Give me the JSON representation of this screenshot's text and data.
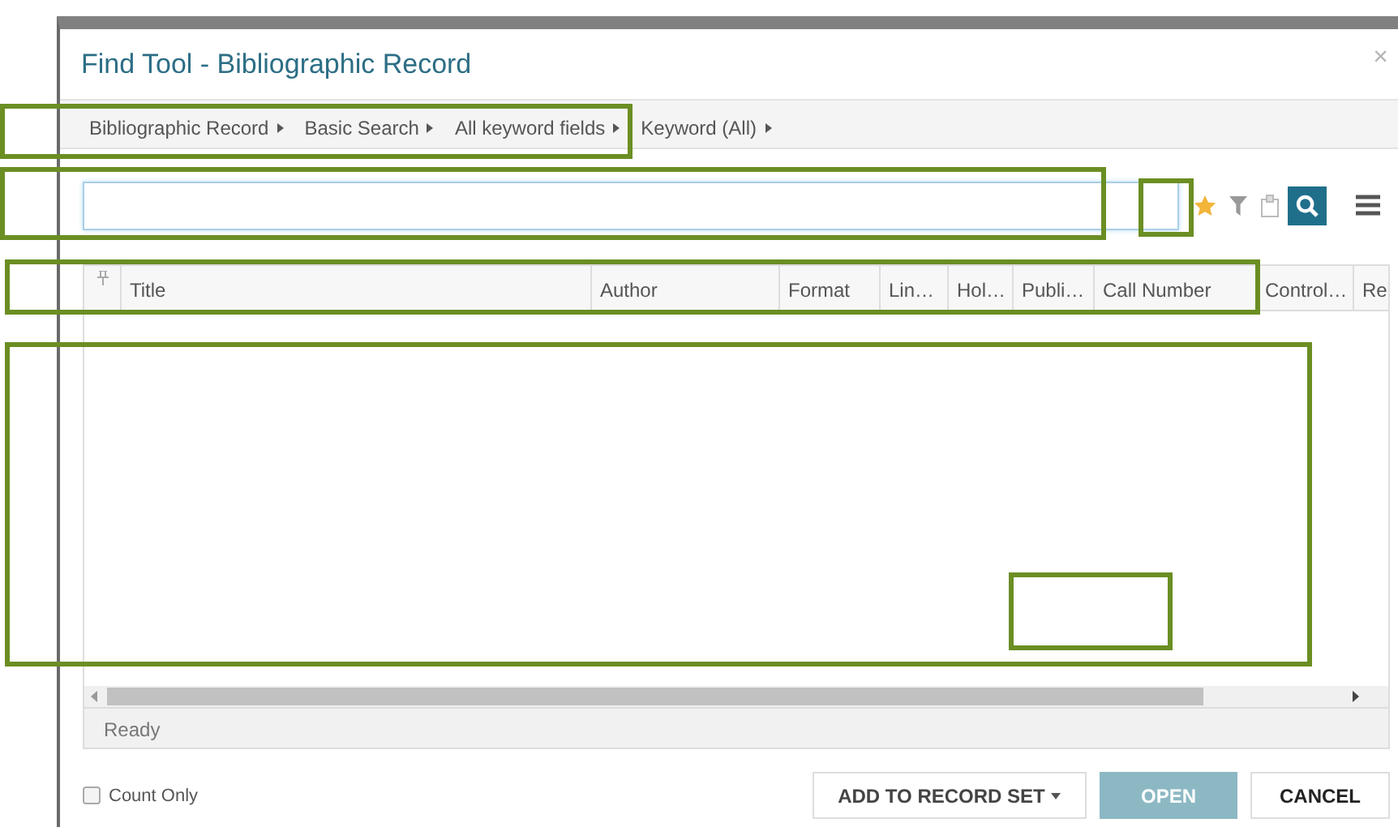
{
  "window": {
    "title": "Find Tool - Bibliographic Record",
    "close": "×"
  },
  "breadcrumb": [
    {
      "label": "Bibliographic Record"
    },
    {
      "label": "Basic Search"
    },
    {
      "label": "All keyword fields"
    },
    {
      "label": "Keyword (All)"
    }
  ],
  "table": {
    "columns": [
      {
        "label": "Title"
      },
      {
        "label": "Author"
      },
      {
        "label": "Format"
      },
      {
        "label": "Lin…"
      },
      {
        "label": "Hol…"
      },
      {
        "label": "Publi…"
      },
      {
        "label": "Call Number"
      },
      {
        "label": "Control…"
      },
      {
        "label": "Re"
      }
    ]
  },
  "status_bar": "Ready",
  "count_only": {
    "label": "Count Only",
    "checked": false
  },
  "buttons": [
    {
      "label": "ADD TO RECORD SET",
      "kind": "dropdown",
      "disabled": false
    },
    {
      "label": "OPEN",
      "kind": "primary",
      "disabled": true
    },
    {
      "label": "CANCEL",
      "kind": "plain",
      "disabled": false
    }
  ],
  "highlight_frames": [
    {
      "kind": "frame"
    },
    {
      "kind": "frame"
    },
    {
      "kind": "frame"
    },
    {
      "kind": "frame"
    },
    {
      "kind": "frame"
    },
    {
      "kind": "frame"
    }
  ]
}
